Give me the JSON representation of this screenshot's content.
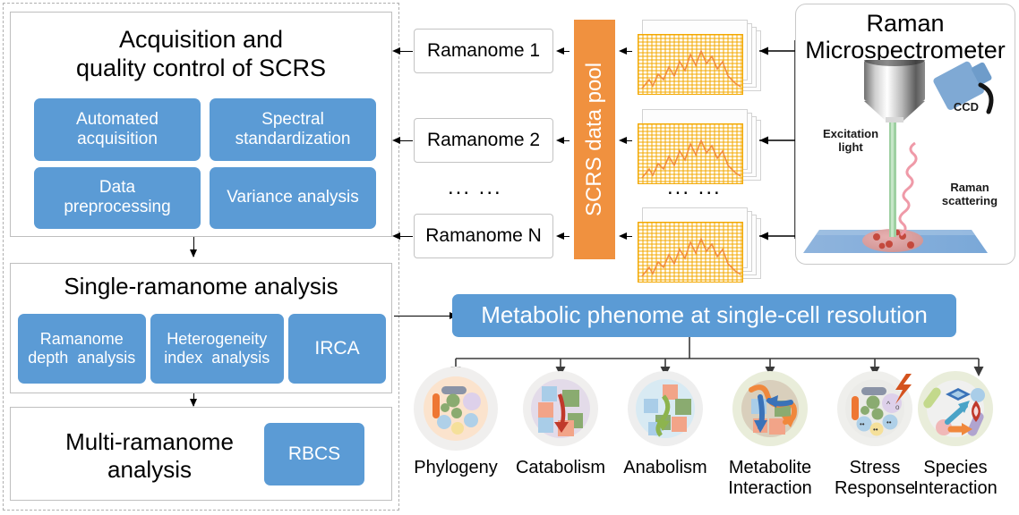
{
  "left_workflow": {
    "acquisition": {
      "title_line1": "Acquisition and",
      "title_line2": "quality control of SCRS",
      "modules": [
        {
          "label": "Automated\nacquisition",
          "name": "automated-acquisition"
        },
        {
          "label": "Spectral\nstandardization",
          "name": "spectral-standardization"
        },
        {
          "label": "Data\npreprocessing",
          "name": "data-preprocessing"
        },
        {
          "label": "Variance  analysis",
          "name": "variance-analysis"
        }
      ]
    },
    "single_ramanome": {
      "title": "Single-ramanome analysis",
      "modules": [
        {
          "label": "Ramanome\ndepth  analysis",
          "name": "ramanome-depth-analysis"
        },
        {
          "label": "Heterogeneity\nindex  analysis",
          "name": "heterogeneity-index-analysis"
        },
        {
          "label": "IRCA",
          "name": "irca"
        }
      ]
    },
    "multi_ramanome": {
      "title_line1": "Multi-ramanome",
      "title_line2": "analysis",
      "module": {
        "label": "RBCS",
        "name": "rbcs"
      }
    }
  },
  "ramanomes": {
    "items": [
      {
        "label": "Ramanome  1"
      },
      {
        "label": "Ramanome  2"
      },
      {
        "label": "Ramanome  N"
      }
    ],
    "ellipsis": "... ..."
  },
  "data_pool": {
    "label": "SCRS data pool",
    "color": "#f0913f"
  },
  "spectra_stacks": {
    "ellipsis": "... ...",
    "grid_color": "#f3a800",
    "trace_color": "#f08a3c",
    "count": 3
  },
  "instrument": {
    "title_line1": "Raman",
    "title_line2": "Microspectrometer",
    "labels": {
      "ccd": "CCD",
      "excitation_line1": "Excitation",
      "excitation_line2": "light",
      "raman_line1": "Raman",
      "raman_line2": "scattering"
    }
  },
  "phenome": {
    "bar_label": "Metabolic phenome at single-cell resolution",
    "accent_blue": "#5b9bd5"
  },
  "phenotypes": [
    {
      "label_line1": "Phylogeny",
      "label_line2": "",
      "halo": "#f0efee",
      "inner": "#fbe3cd",
      "name": "phenotype-phylogeny"
    },
    {
      "label_line1": "Catabolism",
      "label_line2": "",
      "halo": "#f0efee",
      "inner": "#e3dbe9",
      "name": "phenotype-catabolism"
    },
    {
      "label_line1": "Anabolism",
      "label_line2": "",
      "halo": "#eeeeee",
      "inner": "#d8eaf3",
      "name": "phenotype-anabolism"
    },
    {
      "label_line1": "Metabolite",
      "label_line2": "Interaction",
      "halo": "#e9edda",
      "inner": "#d9cfbc",
      "name": "phenotype-metabolite-interaction"
    },
    {
      "label_line1": "Stress",
      "label_line2": "Response",
      "halo": "#efefec",
      "inner": "#ebebe8",
      "name": "phenotype-stress-response"
    },
    {
      "label_line1": "Species",
      "label_line2": "Interaction",
      "halo": "#e9edda",
      "inner": "#f0f0ef",
      "name": "phenotype-species-interaction"
    }
  ]
}
